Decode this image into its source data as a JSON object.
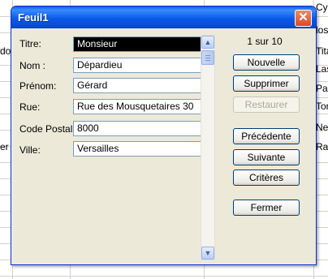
{
  "dialog": {
    "title": "Feuil1",
    "close_glyph": "✕"
  },
  "form": {
    "fields": [
      {
        "label": "Titre:",
        "value": "Monsieur"
      },
      {
        "label": "Nom :",
        "value": "Dépardieu"
      },
      {
        "label": "Prénom:",
        "value": "Gérard"
      },
      {
        "label": "Rue:",
        "value": "Rue des Mousquetaires 30"
      },
      {
        "label": "Code Postal:",
        "value": "8000"
      },
      {
        "label": "Ville:",
        "value": "Versailles"
      }
    ]
  },
  "record_counter": "1 sur 10",
  "buttons": {
    "nouvelle": "Nouvelle",
    "supprimer": "Supprimer",
    "restaurer": "Restaurer",
    "precedente": "Précédente",
    "suivante": "Suivante",
    "criteres": "Critères",
    "fermer": "Fermer"
  },
  "background_sheet": {
    "right_cells": [
      "Cyb",
      "los",
      "Tita",
      "Las",
      "Par",
      "Tor",
      "Nev",
      "Rar"
    ],
    "left_cells": [
      "do",
      "er"
    ]
  },
  "colors": {
    "titlebar": "#0a5be8",
    "dialog_bg": "#ece9d8",
    "close_button": "#d84a2a"
  }
}
